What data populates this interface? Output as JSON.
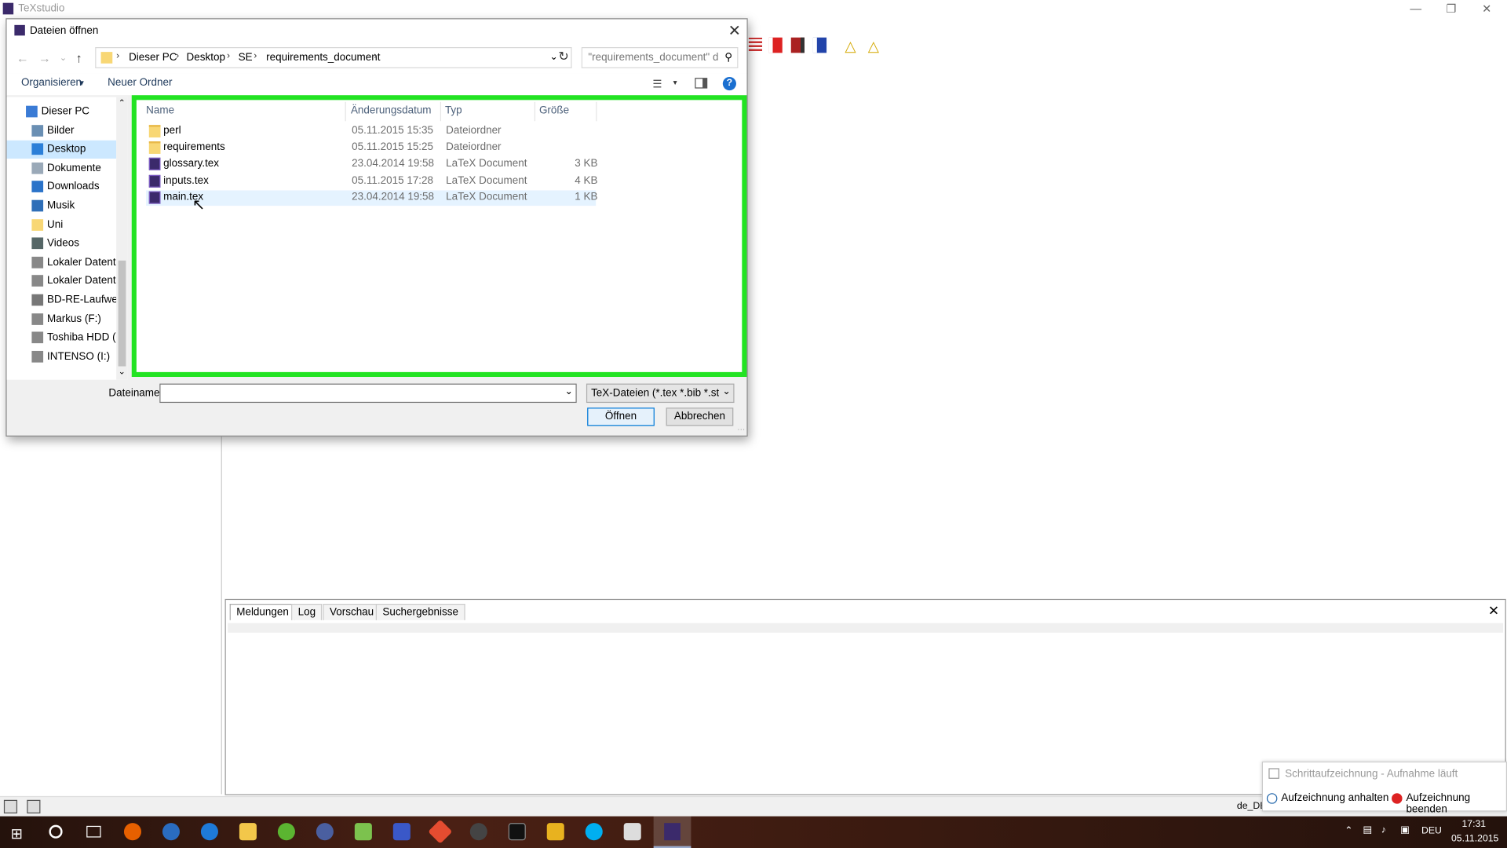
{
  "app": {
    "title": "TeXstudio"
  },
  "dialog": {
    "title": "Dateien öffnen",
    "breadcrumb": [
      "Dieser PC",
      "Desktop",
      "SE",
      "requirements_document"
    ],
    "search_placeholder": "\"requirements_document\" du...",
    "organize_label": "Organisieren",
    "new_folder_label": "Neuer Ordner",
    "nav_items": [
      {
        "label": "Dieser PC",
        "icon": "computer-icon"
      },
      {
        "label": "Bilder",
        "icon": "pictures-icon"
      },
      {
        "label": "Desktop",
        "icon": "desktop-icon",
        "selected": true
      },
      {
        "label": "Dokumente",
        "icon": "documents-icon"
      },
      {
        "label": "Downloads",
        "icon": "download-icon"
      },
      {
        "label": "Musik",
        "icon": "music-icon"
      },
      {
        "label": "Uni",
        "icon": "folder-icon"
      },
      {
        "label": "Videos",
        "icon": "video-icon"
      },
      {
        "label": "Lokaler Datenträ",
        "icon": "drive-icon"
      },
      {
        "label": "Lokaler Datenträ",
        "icon": "drive-icon"
      },
      {
        "label": "BD-RE-Laufwerk",
        "icon": "disc-icon"
      },
      {
        "label": "Markus (F:)",
        "icon": "drive-icon"
      },
      {
        "label": "Toshiba HDD (G:",
        "icon": "drive-icon"
      },
      {
        "label": "INTENSO (I:)",
        "icon": "drive-icon"
      }
    ],
    "columns": {
      "name": "Name",
      "date": "Änderungsdatum",
      "type": "Typ",
      "size": "Größe"
    },
    "files": [
      {
        "name": "perl",
        "date": "05.11.2015 15:35",
        "type": "Dateiordner",
        "size": "",
        "kind": "folder"
      },
      {
        "name": "requirements",
        "date": "05.11.2015 15:25",
        "type": "Dateiordner",
        "size": "",
        "kind": "folder"
      },
      {
        "name": "glossary.tex",
        "date": "23.04.2014 19:58",
        "type": "LaTeX Document",
        "size": "3 KB",
        "kind": "tex"
      },
      {
        "name": "inputs.tex",
        "date": "05.11.2015 17:28",
        "type": "LaTeX Document",
        "size": "4 KB",
        "kind": "tex"
      },
      {
        "name": "main.tex",
        "date": "23.04.2014 19:58",
        "type": "LaTeX Document",
        "size": "1 KB",
        "kind": "tex"
      }
    ],
    "filename_label": "Dateiname:",
    "filename_value": "",
    "filter_label": "TeX-Dateien (*.tex *.bib *.sty *.c",
    "open_label": "Öffnen",
    "cancel_label": "Abbrechen",
    "highlight_color": "#22e322"
  },
  "messages_panel": {
    "tabs": [
      "Meldungen",
      "Log",
      "Vorschau",
      "Suchergebnisse"
    ]
  },
  "statusbar": {
    "lang": "de_DE"
  },
  "recording": {
    "title": "Schrittaufzeichnung - Aufnahme läuft",
    "pause_label": "Aufzeichnung anhalten",
    "stop_label": "Aufzeichnung beenden"
  },
  "taskbar": {
    "lang": "DEU",
    "time": "17:31",
    "date": "05.11.2015"
  }
}
